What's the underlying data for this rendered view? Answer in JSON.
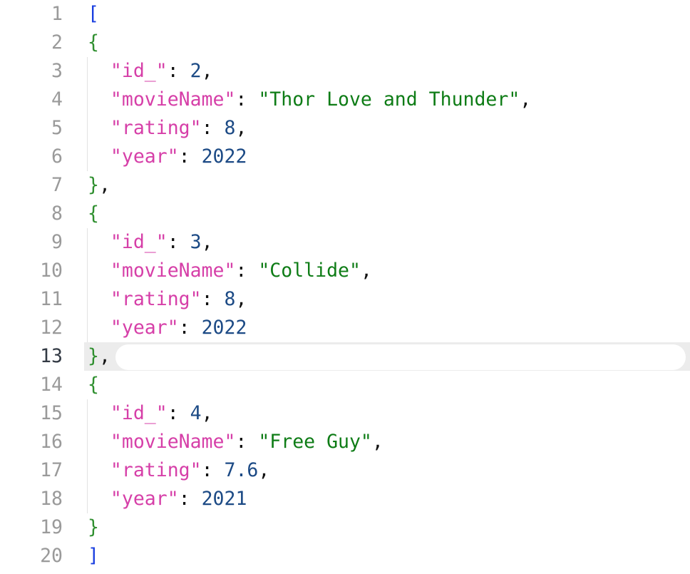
{
  "editor": {
    "active_line": 13,
    "colors": {
      "key": "#d63fa8",
      "string": "#0e7c16",
      "number": "#1c4a85",
      "bracket": "#1a3fe0",
      "brace": "#2f8f2f"
    },
    "lines": [
      {
        "n": "1",
        "tokens": [
          [
            "b1",
            "["
          ]
        ]
      },
      {
        "n": "2",
        "tokens": [
          [
            "b2",
            "{"
          ]
        ]
      },
      {
        "n": "3",
        "tokens": [
          [
            "p",
            "  "
          ],
          [
            "k",
            "\"id_\""
          ],
          [
            "p",
            ": "
          ],
          [
            "n",
            "2"
          ],
          [
            "p",
            ","
          ]
        ]
      },
      {
        "n": "4",
        "tokens": [
          [
            "p",
            "  "
          ],
          [
            "k",
            "\"movieName\""
          ],
          [
            "p",
            ": "
          ],
          [
            "s",
            "\"Thor Love and Thunder\""
          ],
          [
            "p",
            ","
          ]
        ]
      },
      {
        "n": "5",
        "tokens": [
          [
            "p",
            "  "
          ],
          [
            "k",
            "\"rating\""
          ],
          [
            "p",
            ": "
          ],
          [
            "n",
            "8"
          ],
          [
            "p",
            ","
          ]
        ]
      },
      {
        "n": "6",
        "tokens": [
          [
            "p",
            "  "
          ],
          [
            "k",
            "\"year\""
          ],
          [
            "p",
            ": "
          ],
          [
            "n",
            "2022"
          ]
        ]
      },
      {
        "n": "7",
        "tokens": [
          [
            "b2",
            "}"
          ],
          [
            "p",
            ","
          ]
        ]
      },
      {
        "n": "8",
        "tokens": [
          [
            "b2",
            "{"
          ]
        ]
      },
      {
        "n": "9",
        "tokens": [
          [
            "p",
            "  "
          ],
          [
            "k",
            "\"id_\""
          ],
          [
            "p",
            ": "
          ],
          [
            "n",
            "3"
          ],
          [
            "p",
            ","
          ]
        ]
      },
      {
        "n": "10",
        "tokens": [
          [
            "p",
            "  "
          ],
          [
            "k",
            "\"movieName\""
          ],
          [
            "p",
            ": "
          ],
          [
            "s",
            "\"Collide\""
          ],
          [
            "p",
            ","
          ]
        ]
      },
      {
        "n": "11",
        "tokens": [
          [
            "p",
            "  "
          ],
          [
            "k",
            "\"rating\""
          ],
          [
            "p",
            ": "
          ],
          [
            "n",
            "8"
          ],
          [
            "p",
            ","
          ]
        ]
      },
      {
        "n": "12",
        "tokens": [
          [
            "p",
            "  "
          ],
          [
            "k",
            "\"year\""
          ],
          [
            "p",
            ": "
          ],
          [
            "n",
            "2022"
          ]
        ]
      },
      {
        "n": "13",
        "tokens": [
          [
            "b2",
            "}"
          ],
          [
            "p",
            ","
          ]
        ]
      },
      {
        "n": "14",
        "tokens": [
          [
            "b2",
            "{"
          ]
        ]
      },
      {
        "n": "15",
        "tokens": [
          [
            "p",
            "  "
          ],
          [
            "k",
            "\"id_\""
          ],
          [
            "p",
            ": "
          ],
          [
            "n",
            "4"
          ],
          [
            "p",
            ","
          ]
        ]
      },
      {
        "n": "16",
        "tokens": [
          [
            "p",
            "  "
          ],
          [
            "k",
            "\"movieName\""
          ],
          [
            "p",
            ": "
          ],
          [
            "s",
            "\"Free Guy\""
          ],
          [
            "p",
            ","
          ]
        ]
      },
      {
        "n": "17",
        "tokens": [
          [
            "p",
            "  "
          ],
          [
            "k",
            "\"rating\""
          ],
          [
            "p",
            ": "
          ],
          [
            "n",
            "7.6"
          ],
          [
            "p",
            ","
          ]
        ]
      },
      {
        "n": "18",
        "tokens": [
          [
            "p",
            "  "
          ],
          [
            "k",
            "\"year\""
          ],
          [
            "p",
            ": "
          ],
          [
            "n",
            "2021"
          ]
        ]
      },
      {
        "n": "19",
        "tokens": [
          [
            "b2",
            "}"
          ]
        ]
      },
      {
        "n": "20",
        "tokens": [
          [
            "b1",
            "]"
          ]
        ]
      }
    ]
  }
}
